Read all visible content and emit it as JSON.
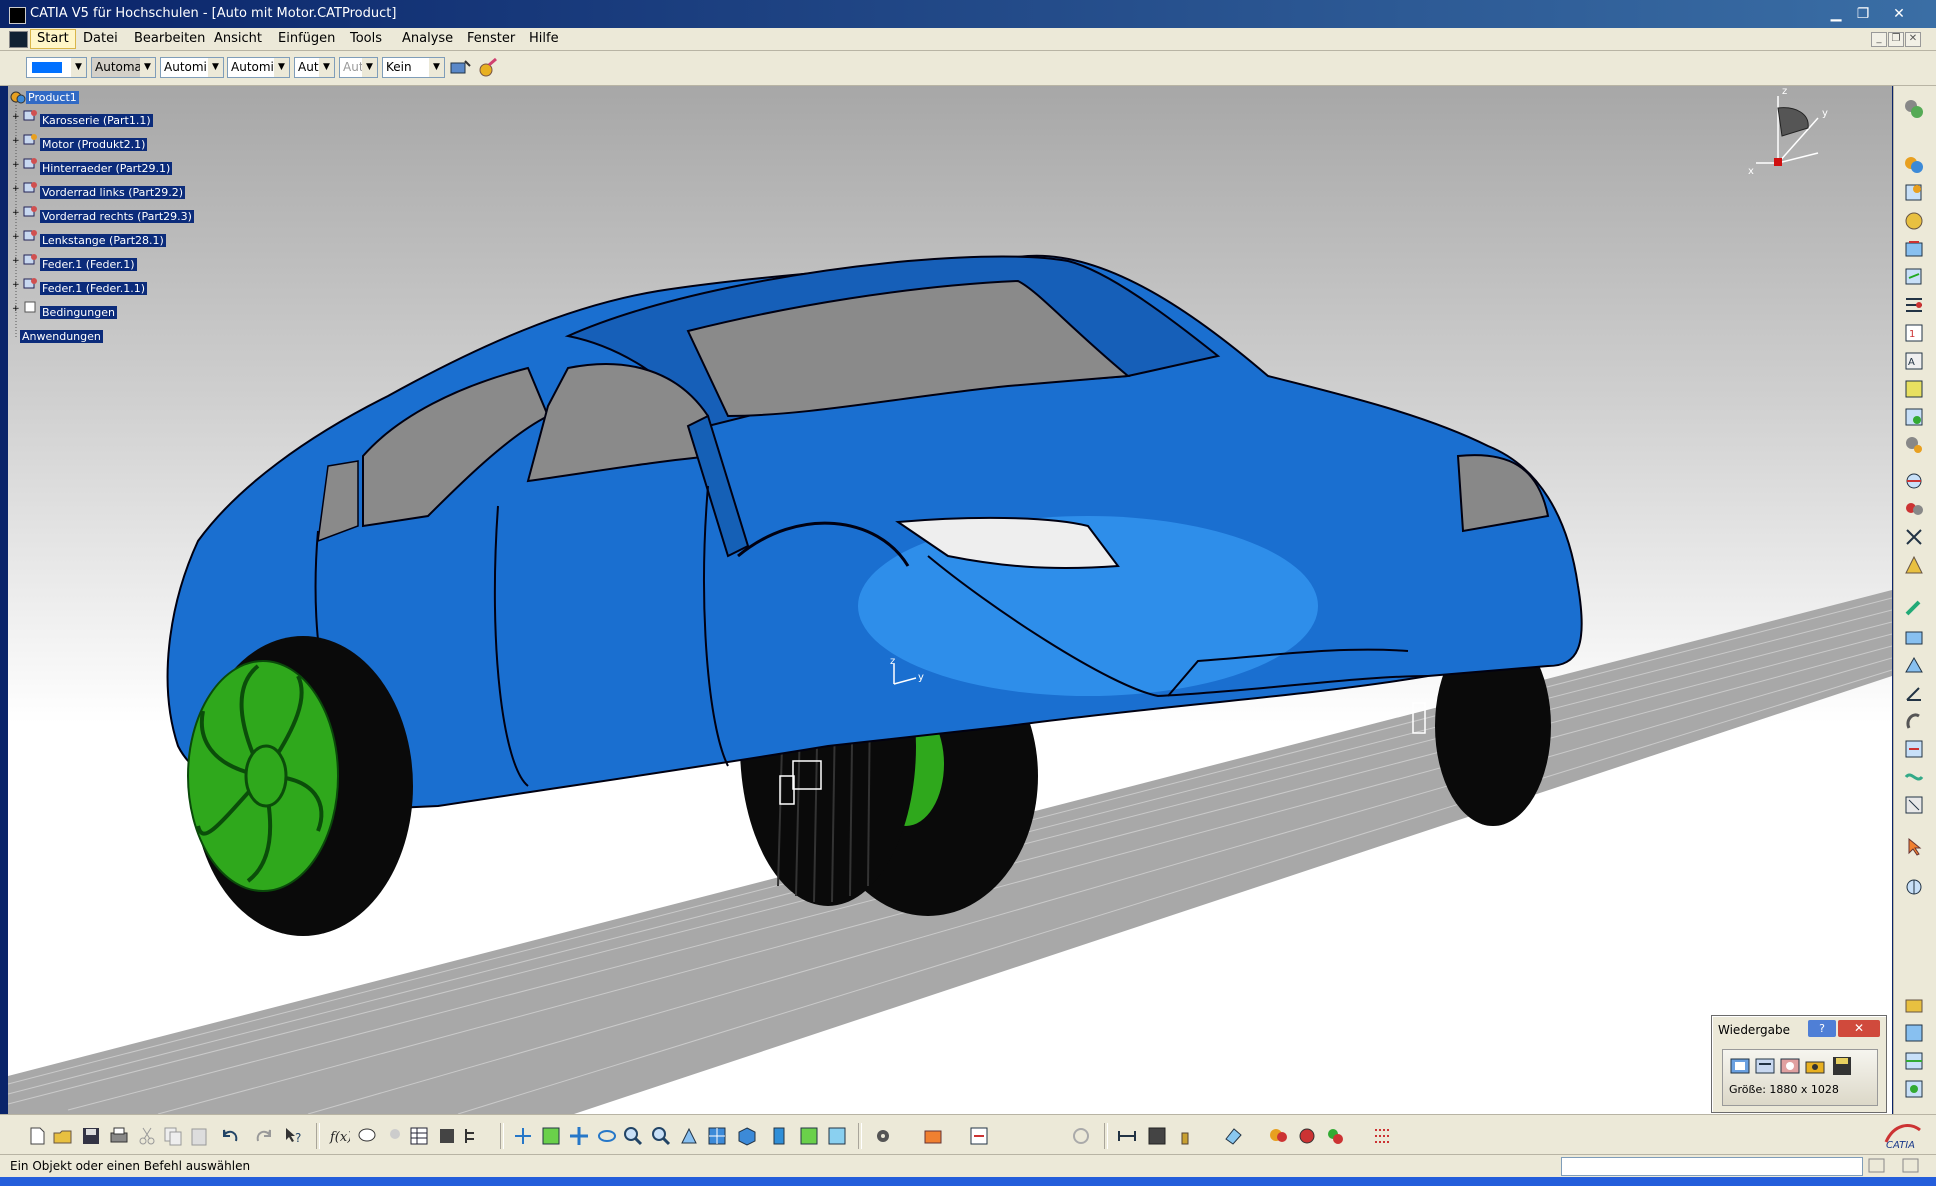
{
  "window": {
    "title": "CATIA V5 für Hochschulen - [Auto mit Motor.CATProduct]",
    "buttons": [
      "minimize-icon",
      "maximize-icon",
      "close-icon"
    ]
  },
  "menu": {
    "items": [
      "Start",
      "Datei",
      "Bearbeiten",
      "Ansicht",
      "Einfügen",
      "Tools",
      "Analyse",
      "Fenster",
      "Hilfe"
    ]
  },
  "toolbar": {
    "color_value": "",
    "fields": [
      {
        "value": "Automa"
      },
      {
        "value": "Automi"
      },
      {
        "value": "Automi"
      },
      {
        "value": "Aut"
      },
      {
        "value": "Aut"
      },
      {
        "value": "Kein"
      }
    ]
  },
  "tree": {
    "root": "Product1",
    "items": [
      "Karosserie (Part1.1)",
      "Motor (Produkt2.1)",
      "Hinterraeder (Part29.1)",
      "Vorderrad links (Part29.2)",
      "Vorderrad rechts (Part29.3)",
      "Lenkstange (Part28.1)",
      "Feder.1 (Feder.1)",
      "Feder.1 (Feder.1.1)",
      "Bedingungen"
    ],
    "applications": "Anwendungen"
  },
  "compass": {
    "x_label": "x",
    "y_label": "y",
    "z_label": "z"
  },
  "axis_marker": {
    "z": "z",
    "y": "y"
  },
  "wiedergabe": {
    "title": "Wiedergabe",
    "help": "?",
    "close": "✕",
    "size_text": "Größe: 1880 x 1028"
  },
  "status": {
    "message": "Ein Objekt oder einen Befehl auswählen"
  },
  "logo": {
    "text": "CATIA"
  },
  "colors": {
    "car_body": "#1a6fd0",
    "wheel_rim": "#2fa81c",
    "tire": "#0a0a0a",
    "glass": "#8a8a8a",
    "selection": "#0b2b7a"
  }
}
